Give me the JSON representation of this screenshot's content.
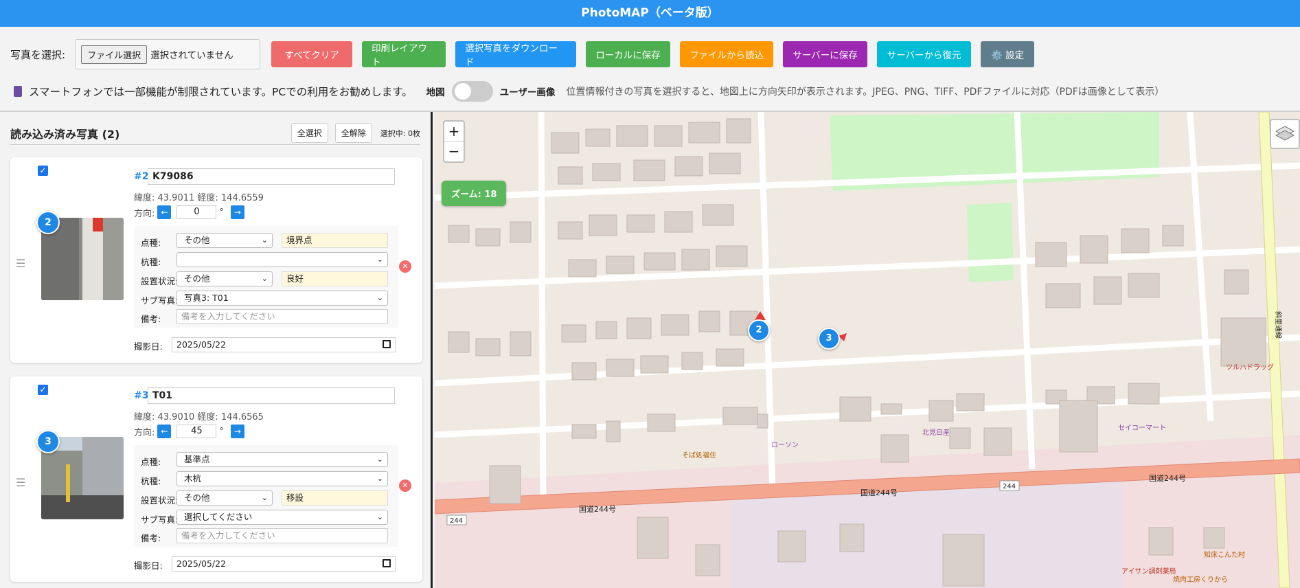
{
  "app": {
    "title": "PhotoMAP（ベータ版）"
  },
  "toolbar": {
    "select_label": "写真を選択:",
    "file_button": "ファイル選択",
    "file_status": "選択されていません",
    "buttons": [
      {
        "label": "すべてクリア",
        "color": "#ef6b6b"
      },
      {
        "label": "印刷レイアウト",
        "color": "#4caf50"
      },
      {
        "label": "選択写真をダウンロード",
        "color": "#2196f3"
      },
      {
        "label": "ローカルに保存",
        "color": "#4caf50"
      },
      {
        "label": "ファイルから読込",
        "color": "#ff9800"
      },
      {
        "label": "サーバーに保存",
        "color": "#9c27b0"
      },
      {
        "label": "サーバーから復元",
        "color": "#00bcd4"
      },
      {
        "label": "⚙️ 設定",
        "color": "#607d8b"
      }
    ],
    "notice": "スマートフォンでは一部機能が制限されています。PCでの利用をお勧めします。",
    "toggle_left": "地図",
    "toggle_right": "ユーザー画像",
    "info": "位置情報付きの写真を選択すると、地図上に方向矢印が表示されます。JPEG、PNG、TIFF、PDFファイルに対応（PDFは画像として表示）"
  },
  "list": {
    "title": "読み込み済み写真 (2)",
    "select_all": "全選択",
    "deselect_all": "全解除",
    "selected_count": "選択中: 0枚",
    "labels": {
      "point_type": "点種:",
      "stake_type": "杭種:",
      "install": "設置状況:",
      "sub_photo": "サブ写真:",
      "memo": "備考:",
      "date": "撮影日:",
      "direction": "方向:",
      "memo_placeholder": "備考を入力してください"
    },
    "photos": [
      {
        "badge": "2",
        "number": "#2",
        "name": "K79086",
        "coords": "緯度: 43.9011 経度: 144.6559",
        "direction": "0",
        "degree": "°",
        "point_type": "その他",
        "point_note": "境界点",
        "stake_type": "",
        "install": "その他",
        "install_note": "良好",
        "sub_photo": "写真3: T01",
        "date": "2025/05/22"
      },
      {
        "badge": "3",
        "number": "#3",
        "name": "T01",
        "coords": "緯度: 43.9010 経度: 144.6565",
        "direction": "45",
        "degree": "°",
        "point_type": "基準点",
        "point_note": "",
        "stake_type": "木杭",
        "install": "その他",
        "install_note": "移設",
        "sub_photo": "選択してください",
        "date": "2025/05/22"
      }
    ]
  },
  "map": {
    "zoom_in": "+",
    "zoom_out": "−",
    "zoom_label": "ズーム: 18",
    "road_label": "国道244号",
    "route_number": "244",
    "pois": [
      "ツルハドラッグ",
      "北見日産",
      "セイコーマート",
      "ローソン",
      "そば処福住",
      "アイサン調剤薬局",
      "焼肉工房くりから",
      "知床こんた村"
    ],
    "street_label": "斜里通線",
    "markers": [
      "2",
      "3"
    ]
  }
}
